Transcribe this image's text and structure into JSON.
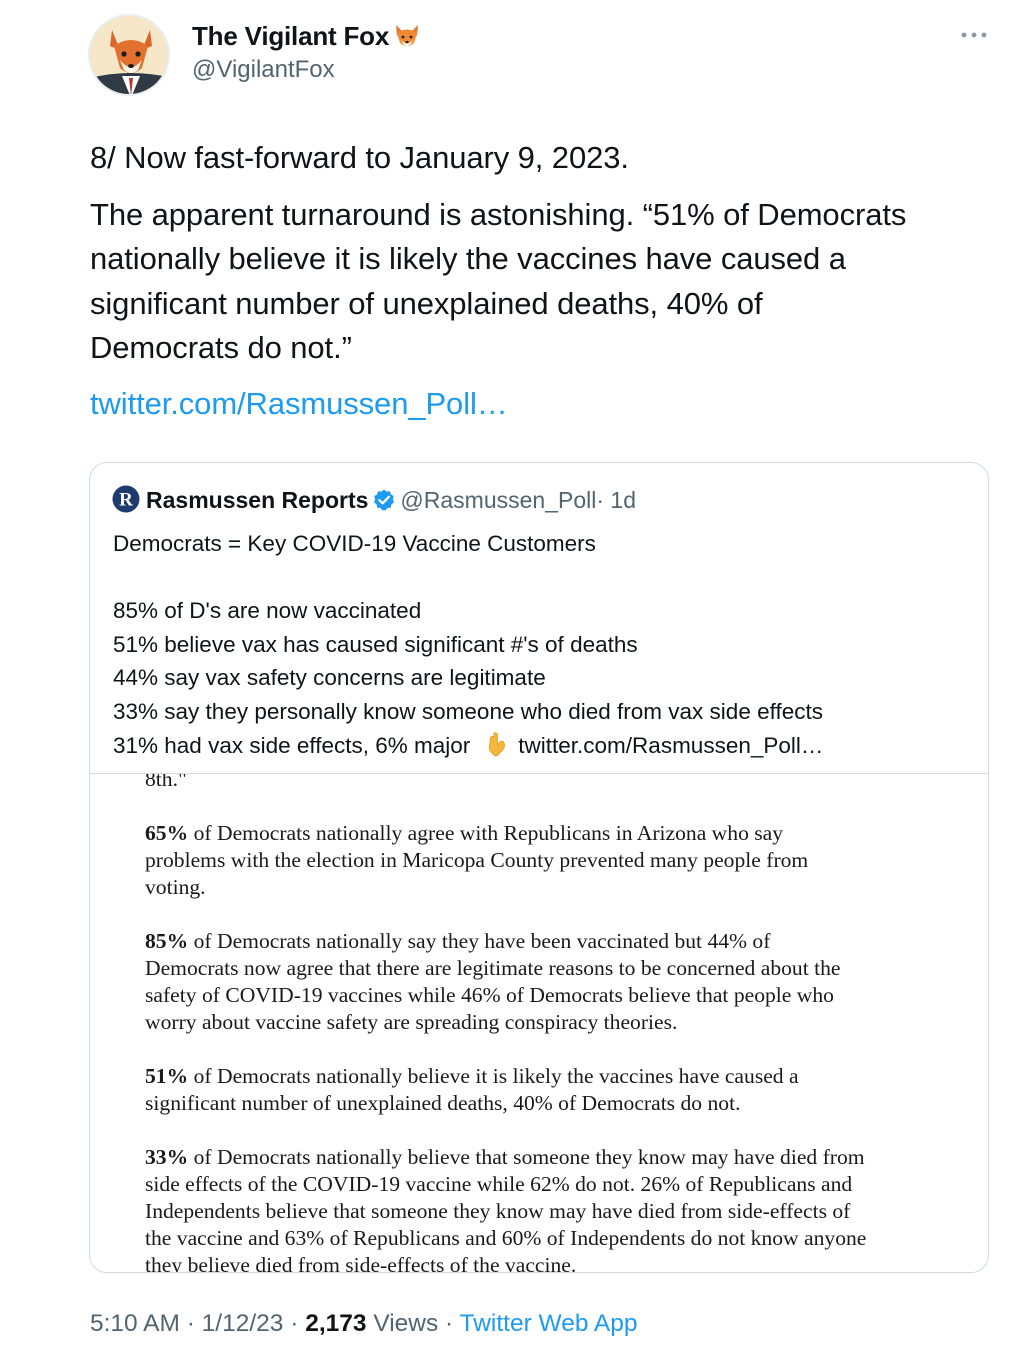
{
  "author": {
    "name": "The Vigilant Fox",
    "name_emoji": "fox-face",
    "handle": "@VigilantFox",
    "avatar": "fox-in-suit-avatar"
  },
  "tweet": {
    "para1": "8/ Now fast-forward to January 9, 2023.",
    "para2": "The apparent turnaround is astonishing. “51% of Democrats\nnationally believe it is likely the vaccines have caused a\nsignificant number of unexplained deaths, 40% of\nDemocrats do not.”",
    "link": "twitter.com/Rasmussen_Poll…"
  },
  "quoted": {
    "name": "Rasmussen Reports",
    "handle": "@Rasmussen_Poll",
    "age": "· 1d",
    "verified": true,
    "body_title": "Democrats = Key COVID-19 Vaccine Customers",
    "lines": [
      "85% of D's are now vaccinated",
      "51% believe vax has caused significant #'s of deaths",
      "44% say vax safety concerns are legitimate",
      "33% say they personally know someone who died from vax side effects"
    ],
    "last_line": "31% had vax side effects, 6% major",
    "inline_emoji": "backhand-index-pointing-down",
    "inline_link": "twitter.com/Rasmussen_Poll…",
    "image": {
      "top_fragment": "8th.\"",
      "paragraphs": [
        {
          "lead": "65%",
          "text": " of Democrats nationally agree with Republicans in Arizona who say\nproblems with the election in Maricopa County prevented many people from\nvoting."
        },
        {
          "lead": "85%",
          "text": " of Democrats nationally say they have been vaccinated but 44% of\nDemocrats now agree that there are legitimate reasons to be concerned about the\nsafety of COVID-19 vaccines while 46% of Democrats believe that people who\nworry about vaccine safety are spreading conspiracy theories."
        },
        {
          "lead": "51%",
          "text": " of Democrats nationally believe it is likely the vaccines have caused a\nsignificant number of unexplained deaths, 40% of Democrats do not."
        },
        {
          "lead": "33%",
          "text": " of Democrats nationally believe that someone they know may have died from\nside effects of the COVID-19 vaccine while 62% do not. 26% of Republicans and\nIndependents believe that someone they know may have died from side-effects of\nthe vaccine and 63% of Republicans and 60% of Independents do not know anyone\nthey believe died from side-effects of the vaccine."
        }
      ]
    }
  },
  "meta": {
    "time": "5:10 AM",
    "sep1": " · ",
    "date": "1/12/23",
    "sep2": " · ",
    "views_count": "2,173",
    "views_label": " Views",
    "sep3": " · ",
    "app": "Twitter Web App"
  },
  "colors": {
    "link": "#1d9bf0",
    "secondary_text": "#536471",
    "border": "#cfd9de",
    "verified": "#1d9bf0"
  }
}
